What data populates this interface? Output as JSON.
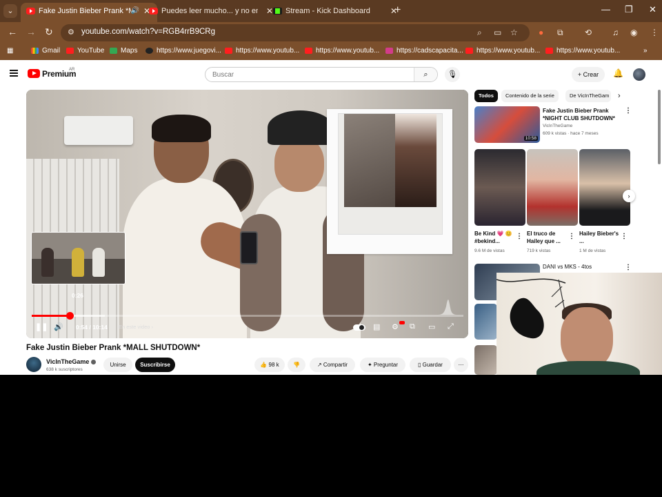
{
  "browser": {
    "tabs": [
      {
        "title": "Fake Justin Bieber Prank *M",
        "active": true,
        "favicon": "youtube-favicon"
      },
      {
        "title": "Puedes leer mucho... y no ente",
        "active": false,
        "favicon": "youtube-favicon"
      },
      {
        "title": "Stream - Kick Dashboard",
        "active": false,
        "favicon": "kick-favicon"
      }
    ],
    "url": "youtube.com/watch?v=RGB4rrB9CRg",
    "bookmarks": [
      {
        "label": "Gmail",
        "icon": "gmail-icon"
      },
      {
        "label": "YouTube",
        "icon": "youtube-icon"
      },
      {
        "label": "Maps",
        "icon": "maps-icon"
      },
      {
        "label": "https://www.juegovi...",
        "icon": "site-icon"
      },
      {
        "label": "https://www.youtub...",
        "icon": "youtube-icon"
      },
      {
        "label": "https://www.youtub...",
        "icon": "youtube-icon"
      },
      {
        "label": "https://cadscapacita...",
        "icon": "site-icon"
      },
      {
        "label": "https://www.youtub...",
        "icon": "youtube-icon"
      },
      {
        "label": "https://www.youtub...",
        "icon": "youtube-icon"
      }
    ]
  },
  "header": {
    "brand": "Premium",
    "region": "AR",
    "search_placeholder": "Buscar",
    "create_label": "Crear"
  },
  "player": {
    "preview_time": "0:26",
    "current_time": "0:54",
    "duration": "10:14",
    "time_display": "0:54 / 10:14",
    "chapter_label": "En este video",
    "progress_fraction": 0.088,
    "buffer_fraction": 0.17,
    "hd_badge": "HD"
  },
  "video": {
    "title": "Fake Justin Bieber Prank *MALL SHUTDOWN*",
    "channel": "VicInTheGame",
    "subscribers": "638 k suscriptores",
    "join_label": "Unirse",
    "subscribe_label": "Suscribirse",
    "likes": "98 k",
    "share_label": "Compartir",
    "ask_label": "Preguntar",
    "save_label": "Guardar"
  },
  "sidebar": {
    "chips": [
      "Todos",
      "Contenido de la serie",
      "De VicInTheGam"
    ],
    "rec1": {
      "title": "Fake Justin Bieber Prank *NIGHT CLUB SHUTDOWN*",
      "channel": "VicInTheGame",
      "meta": "609 k vistas · hace 7 meses",
      "duration": "10:58"
    },
    "shorts": [
      {
        "title": "Be Kind 💗 😊 #bekind...",
        "views": "9.6 M de vistas"
      },
      {
        "title": "El truco de Hailey que ...",
        "views": "719 k vistas"
      },
      {
        "title": "Hailey Bieber's ...",
        "views": "1 M de vistas"
      }
    ],
    "rec2": {
      "title": "DANI vs MKS - 4tos"
    }
  },
  "colors": {
    "chrome_frame": "#5a3a22",
    "chrome_toolbar": "#7b4f2c",
    "youtube_red": "#ff0000",
    "subscribe_bg": "#0f0f0f"
  }
}
